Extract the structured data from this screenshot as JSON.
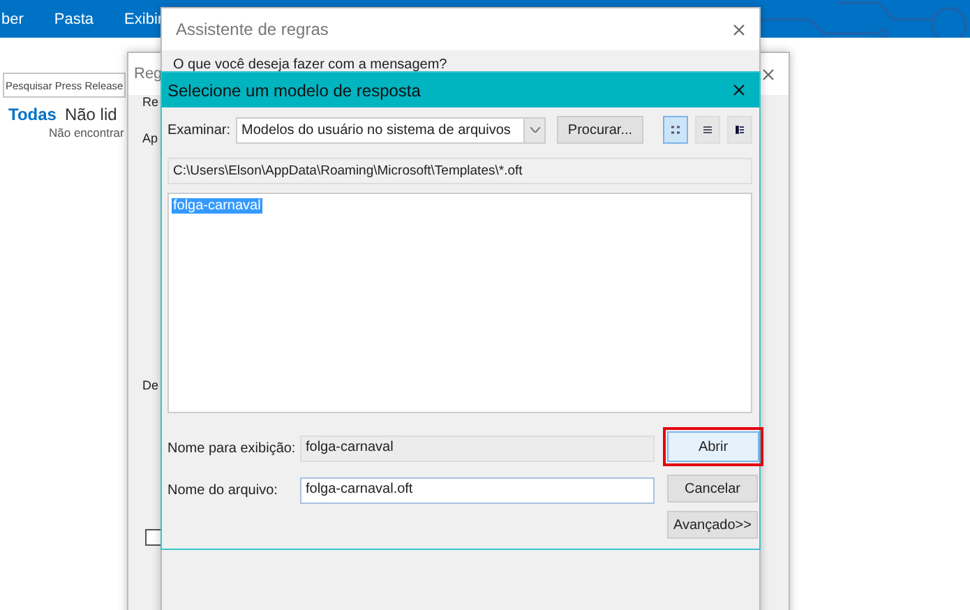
{
  "ribbon": {
    "tabs": [
      {
        "label": "ber"
      },
      {
        "label": "Pasta"
      },
      {
        "label": "Exibir"
      }
    ]
  },
  "mail_pane": {
    "search": {
      "placeholder": "Pesquisar Press Release"
    },
    "filters": [
      {
        "label": "Todas",
        "selected": true
      },
      {
        "label": "Não lid",
        "selected": false
      }
    ],
    "empty_message": "Não encontrar"
  },
  "rules_window": {
    "title": "Reg",
    "labels": [
      "Re",
      "Ap",
      "De"
    ],
    "checkbox": {
      "checked": false
    }
  },
  "wizard_window": {
    "title": "Assistente de regras",
    "question": "O que você deseja fazer com a mensagem?"
  },
  "dialog": {
    "title": "Selecione um modelo de resposta",
    "look_in": {
      "label": "Examinar:",
      "value": "Modelos do usuário no sistema de arquivos"
    },
    "browse_button": "Procurar...",
    "view_buttons": [
      {
        "selected": true
      },
      {
        "selected": false
      },
      {
        "selected": false
      }
    ],
    "path": "C:\\Users\\Elson\\AppData\\Roaming\\Microsoft\\Templates\\*.oft",
    "files": [
      {
        "name": "folga-carnaval",
        "selected": true
      }
    ],
    "display_name": {
      "label": "Nome para exibição:",
      "value": "folga-carnaval"
    },
    "file_name": {
      "label": "Nome do arquivo:",
      "value": "folga-carnaval.oft"
    },
    "buttons": [
      {
        "label": "Abrir",
        "highlighted": true,
        "default": true
      },
      {
        "label": "Cancelar",
        "highlighted": false,
        "default": false
      },
      {
        "label": "Avançado>>",
        "highlighted": false,
        "default": false
      }
    ]
  }
}
